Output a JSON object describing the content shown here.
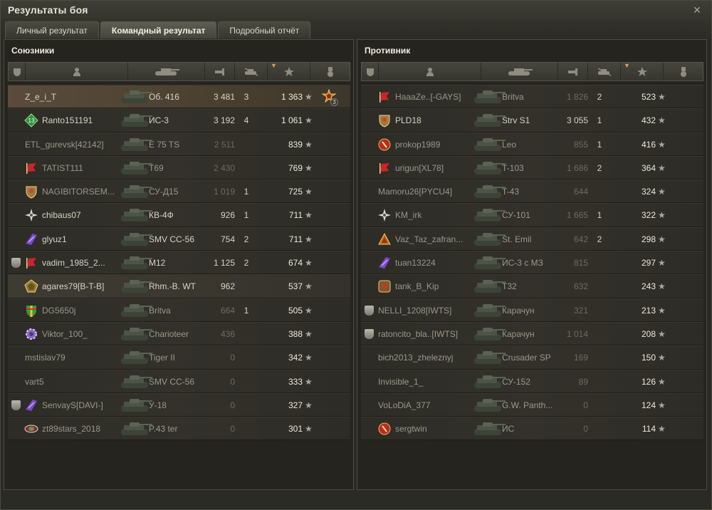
{
  "window": {
    "title": "Результаты боя",
    "close_label": "×"
  },
  "tabs": [
    {
      "label": "Личный результат",
      "active": false
    },
    {
      "label": "Командный результат",
      "active": true
    },
    {
      "label": "Подробный отчёт",
      "active": false
    }
  ],
  "colors": {
    "accent_sort": "#d4a64a",
    "player_row": "#5a4b3a",
    "panel_bg": "#25241f"
  },
  "allies": {
    "title": "Союзники",
    "rows": [
      {
        "name": "Z_e_i_T",
        "badge": "none",
        "platoon": false,
        "tank": "Об. 416",
        "damage": "3 481",
        "kills": "3",
        "xp": "1 363",
        "highlight": "player",
        "medal": {
          "icon": "medal-icon",
          "count": "3"
        }
      },
      {
        "name": "Ranto151191",
        "badge": "green-diamond",
        "badge_text": "13",
        "platoon": false,
        "tank": "ИС-3",
        "damage": "3 192",
        "kills": "4",
        "xp": "1 061"
      },
      {
        "name": "ETL_gurevsk[42142]",
        "badge": "none",
        "platoon": false,
        "tank": "E 75 TS",
        "damage": "2 511",
        "kills": "",
        "xp": "839",
        "dead": true,
        "dim_damage": true
      },
      {
        "name": "TATIST111",
        "badge": "red-flag",
        "platoon": false,
        "tank": "T69",
        "damage": "2 430",
        "kills": "",
        "xp": "769",
        "dead": true,
        "dim_damage": true
      },
      {
        "name": "NAGIBITORSEM...",
        "badge": "shield-gold",
        "platoon": false,
        "tank": "СУ-Д15",
        "damage": "1 019",
        "kills": "1",
        "xp": "725",
        "dead": true,
        "dim_damage": true
      },
      {
        "name": "chibaus07",
        "badge": "white-star",
        "platoon": false,
        "tank": "КВ-4Ф",
        "damage": "926",
        "kills": "1",
        "xp": "711"
      },
      {
        "name": "glyuz1",
        "badge": "purple-wings",
        "platoon": false,
        "tank": "SMV CC-56",
        "damage": "754",
        "kills": "2",
        "xp": "711"
      },
      {
        "name": "vadim_1985_2...",
        "badge": "red-flag",
        "platoon": true,
        "tank": "M12",
        "damage": "1 125",
        "kills": "2",
        "xp": "674"
      },
      {
        "name": "agares79[B-T-B]",
        "badge": "gold-pentagon",
        "platoon": false,
        "tank": "Rhm.-B. WT",
        "damage": "962",
        "kills": "",
        "xp": "537",
        "highlight": "squad"
      },
      {
        "name": "DG5650j",
        "badge": "rainbow-shield",
        "platoon": false,
        "tank": "Britva",
        "damage": "664",
        "kills": "1",
        "xp": "505",
        "dead": true,
        "dim_damage": true
      },
      {
        "name": "Viktor_100_",
        "badge": "purple-gear",
        "platoon": false,
        "tank": "Charioteer",
        "damage": "436",
        "kills": "",
        "xp": "388",
        "dead": true,
        "dim_damage": true
      },
      {
        "name": "mstislav79",
        "badge": "none",
        "platoon": false,
        "tank": "Tiger II",
        "damage": "0",
        "kills": "",
        "xp": "342",
        "dead": true,
        "dim_damage": true
      },
      {
        "name": "vart5",
        "badge": "none",
        "platoon": false,
        "tank": "SMV CC-56",
        "damage": "0",
        "kills": "",
        "xp": "333",
        "dead": true,
        "dim_damage": true
      },
      {
        "name": "SenvayS[DAVI-]",
        "badge": "purple-wings",
        "platoon": true,
        "tank": "У-18",
        "damage": "0",
        "kills": "",
        "xp": "327",
        "dead": true,
        "dim_damage": true
      },
      {
        "name": "zt89stars_2018",
        "badge": "red-eye",
        "platoon": false,
        "tank": "P.43 ter",
        "damage": "0",
        "kills": "",
        "xp": "301",
        "dead": true,
        "dim_damage": true
      }
    ]
  },
  "enemies": {
    "title": "Противник",
    "rows": [
      {
        "name": "HaaaZe..[-GAYS]",
        "badge": "red-flag",
        "platoon": false,
        "tank": "Britva",
        "damage": "1 826",
        "kills": "2",
        "xp": "523",
        "dead": true,
        "dim_damage": true
      },
      {
        "name": "PLD18",
        "badge": "shield-gold",
        "platoon": false,
        "tank": "Strv S1",
        "damage": "3 055",
        "kills": "1",
        "xp": "432"
      },
      {
        "name": "prokop1989",
        "badge": "red-circle",
        "platoon": false,
        "tank": "Leo",
        "damage": "855",
        "kills": "1",
        "xp": "416",
        "dead": true,
        "dim_damage": true
      },
      {
        "name": "urigun[XL78]",
        "badge": "red-flag",
        "platoon": false,
        "tank": "T-103",
        "damage": "1 686",
        "kills": "2",
        "xp": "364",
        "dead": true,
        "dim_damage": true
      },
      {
        "name": "Mamoru26[PYCU4]",
        "badge": "none",
        "platoon": false,
        "tank": "T-43",
        "damage": "644",
        "kills": "",
        "xp": "324",
        "dead": true,
        "dim_damage": true
      },
      {
        "name": "KM_irk",
        "badge": "white-star",
        "platoon": false,
        "tank": "СУ-101",
        "damage": "1 665",
        "kills": "1",
        "xp": "322",
        "dead": true,
        "dim_damage": true
      },
      {
        "name": "Vaz_Taz_zafran...",
        "badge": "orange-triangle",
        "platoon": false,
        "tank": "St. Emil",
        "damage": "642",
        "kills": "2",
        "xp": "298",
        "dead": true,
        "dim_damage": true
      },
      {
        "name": "tuan13224",
        "badge": "purple-wings",
        "platoon": false,
        "tank": "ИС-3 с МЗ",
        "damage": "815",
        "kills": "",
        "xp": "297",
        "dead": true,
        "dim_damage": true
      },
      {
        "name": "tank_B_Kip",
        "badge": "gold-star",
        "platoon": false,
        "tank": "T32",
        "damage": "632",
        "kills": "",
        "xp": "243",
        "dead": true,
        "dim_damage": true
      },
      {
        "name": "NELLI_1208[IWTS]",
        "badge": "none",
        "platoon": true,
        "tank": "Карачун",
        "damage": "321",
        "kills": "",
        "xp": "213",
        "dead": true,
        "dim_damage": true
      },
      {
        "name": "ratoncito_bla..[IWTS]",
        "badge": "none",
        "platoon": true,
        "tank": "Карачун",
        "damage": "1 014",
        "kills": "",
        "xp": "208",
        "dead": true,
        "dim_damage": true
      },
      {
        "name": "bich2013_zheleznyj",
        "badge": "none",
        "platoon": false,
        "tank": "Crusader SP",
        "damage": "169",
        "kills": "",
        "xp": "150",
        "dead": true,
        "dim_damage": true
      },
      {
        "name": "Invisible_1_",
        "badge": "none",
        "platoon": false,
        "tank": "СУ-152",
        "damage": "89",
        "kills": "",
        "xp": "126",
        "dead": true,
        "dim_damage": true
      },
      {
        "name": "VoLoDiA_377",
        "badge": "none",
        "platoon": false,
        "tank": "G.W. Panth...",
        "damage": "0",
        "kills": "",
        "xp": "124",
        "dead": true,
        "dim_damage": true
      },
      {
        "name": "sergtwin",
        "badge": "red-circle",
        "platoon": false,
        "tank": "ИС",
        "damage": "0",
        "kills": "",
        "xp": "114",
        "dead": true,
        "dim_damage": true
      }
    ]
  },
  "columns": {
    "platoon_icon": "platoon-icon",
    "player_icon": "player-icon",
    "tank_icon": "tank-icon",
    "damage_icon": "damage-icon",
    "kills_icon": "kills-icon",
    "xp_icon": "xp-star-icon",
    "medal_icon": "medal-column-icon",
    "sort_column": "xp"
  }
}
